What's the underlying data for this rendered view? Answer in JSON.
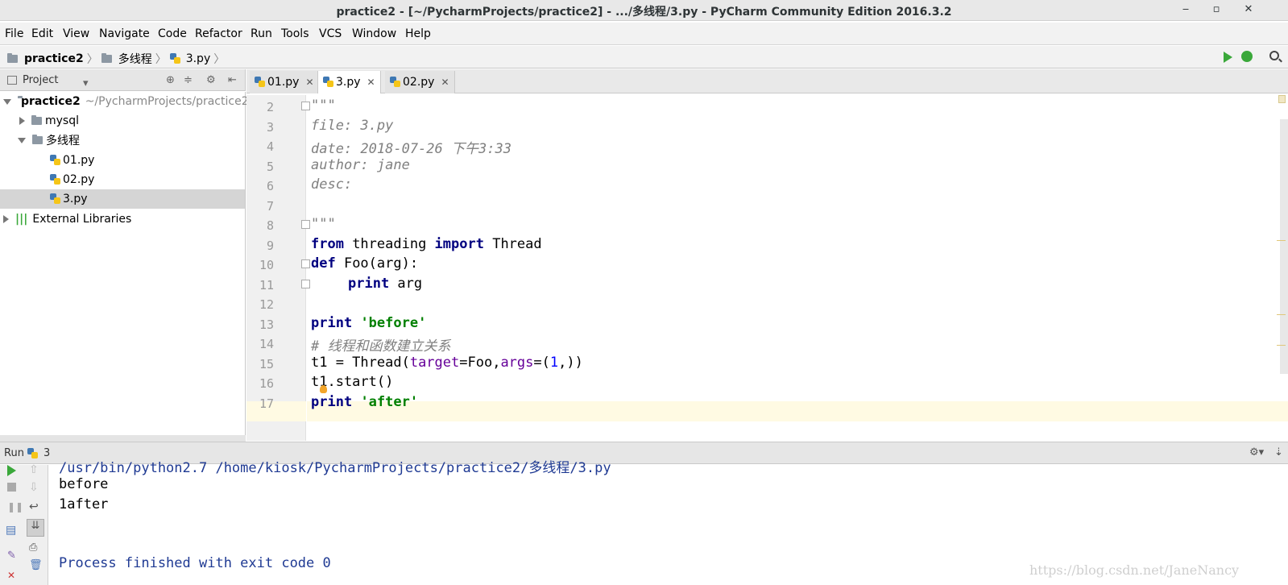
{
  "window": {
    "title": "practice2 - [~/PycharmProjects/practice2] - .../多线程/3.py - PyCharm Community Edition 2016.3.2",
    "min": "‒",
    "max": "▫",
    "close": "✕"
  },
  "menu": [
    "File",
    "Edit",
    "View",
    "Navigate",
    "Code",
    "Refactor",
    "Run",
    "Tools",
    "VCS",
    "Window",
    "Help"
  ],
  "breadcrumb": [
    "practice2",
    "多线程",
    "3.py"
  ],
  "run_config": "3",
  "project_panel": {
    "title": "Project",
    "root": "practice2",
    "root_path": "~/PycharmProjects/practice2",
    "items": [
      "mysql",
      "多线程",
      "01.py",
      "02.py",
      "3.py",
      "External Libraries"
    ]
  },
  "tabs": [
    "01.py",
    "3.py",
    "02.py"
  ],
  "editor": {
    "line_numbers": [
      "2",
      "3",
      "4",
      "5",
      "6",
      "7",
      "8",
      "9",
      "10",
      "11",
      "12",
      "13",
      "14",
      "15",
      "16",
      "17"
    ],
    "lines": {
      "l2": "\"\"\"",
      "l3": "file: 3.py",
      "l4": "date: 2018-07-26 下午3:33",
      "l5": "author: jane",
      "l6": "desc:",
      "l7": "",
      "l8": "\"\"\"",
      "l9_from": "from",
      "l9_mod": " threading ",
      "l9_import": "import",
      "l9_name": " Thread",
      "l10_def": "def",
      "l10_rest": " Foo(arg):",
      "l11_print": "print",
      "l11_rest": " arg",
      "l13_print": "print",
      "l13_str": "'before'",
      "l14": "# 线程和函数建立关系",
      "l15_a": "t1 = Thread(",
      "l15_target": "target",
      "l15_b": "=Foo,",
      "l15_args": "args",
      "l15_c": "=(",
      "l15_num": "1",
      "l15_d": ",))",
      "l16": "t1.start()",
      "l17_print": "print",
      "l17_str": "'after'"
    }
  },
  "run_panel": {
    "label": "Run",
    "config": "3",
    "output": {
      "cmd": "/usr/bin/python2.7 /home/kiosk/PycharmProjects/practice2/多线程/3.py",
      "line1": "before",
      "line2": "1after",
      "finish": "Process finished with exit code 0"
    }
  },
  "watermark": "https://blog.csdn.net/JaneNancy"
}
